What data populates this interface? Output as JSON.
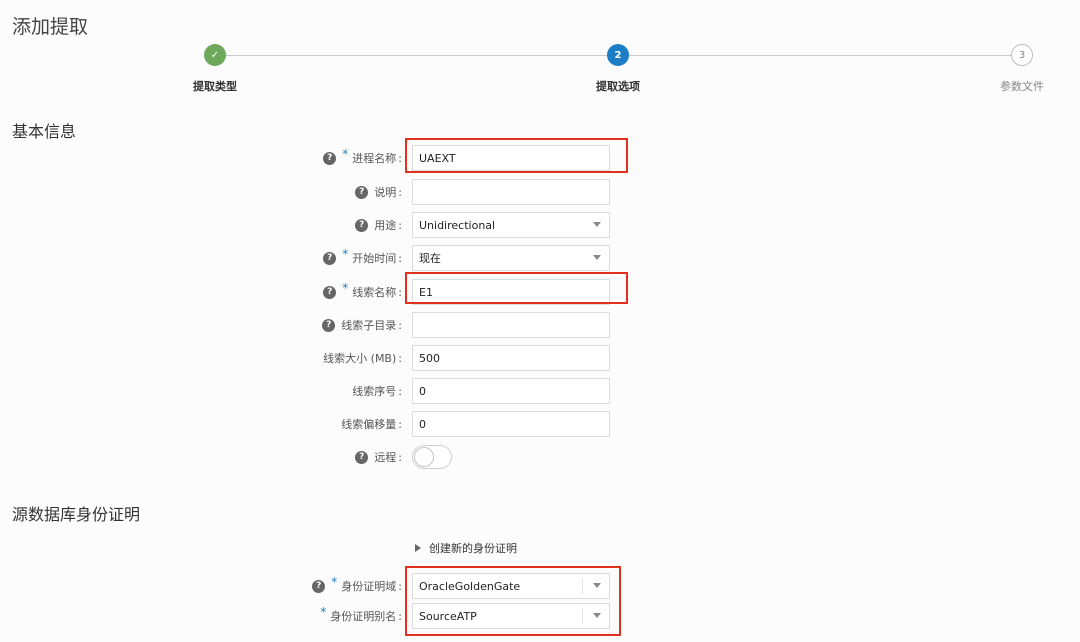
{
  "page": {
    "title": "添加提取"
  },
  "steps": [
    {
      "label": "提取类型",
      "marker": "✓",
      "state": "done"
    },
    {
      "label": "提取选项",
      "marker": "2",
      "state": "active"
    },
    {
      "label": "参数文件",
      "marker": "3",
      "state": "pending"
    }
  ],
  "sections": {
    "basic": "基本信息",
    "credentials": "源数据库身份证明"
  },
  "fields": {
    "process_name": {
      "label": "进程名称",
      "value": "UAEXT"
    },
    "description": {
      "label": "说明",
      "value": ""
    },
    "usage": {
      "label": "用途",
      "value": "Unidirectional"
    },
    "start_time": {
      "label": "开始时间",
      "value": "现在"
    },
    "trail_name": {
      "label": "线索名称",
      "value": "E1"
    },
    "trail_subdir": {
      "label": "线索子目录",
      "value": ""
    },
    "trail_size": {
      "label": "线索大小 (MB)",
      "value": "500"
    },
    "trail_seq": {
      "label": "线索序号",
      "value": "0"
    },
    "trail_offset": {
      "label": "线索偏移量",
      "value": "0"
    },
    "remote": {
      "label": "远程",
      "value": "off"
    },
    "cred_domain": {
      "label": "身份证明域",
      "value": "OracleGoldenGate"
    },
    "cred_alias": {
      "label": "身份证明别名",
      "value": "SourceATP"
    }
  },
  "create_credential": "创建新的身份证明",
  "colors": {
    "done": "#6ea85a",
    "active": "#1d7ec6",
    "required": "#1d7ec6",
    "highlight": "#e0301e"
  }
}
